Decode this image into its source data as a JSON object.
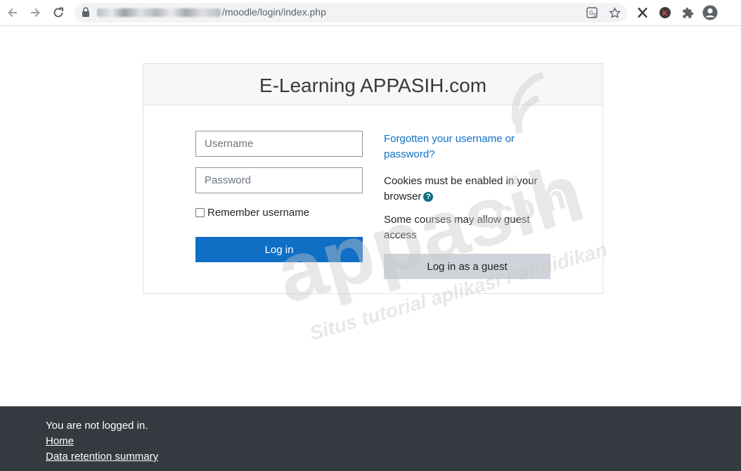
{
  "browser": {
    "url_visible": "/moodle/login/index.php",
    "icons": {
      "back": "arrow-left-icon",
      "forward": "arrow-right-icon",
      "reload": "reload-icon",
      "lock": "lock-icon",
      "translate": "translate-icon",
      "bookmark": "star-icon",
      "ext1": "x-extension-icon",
      "ext2": "k-extension-icon",
      "extensions": "puzzle-icon",
      "profile": "profile-icon"
    },
    "ext2_letter": "K"
  },
  "login": {
    "site_title": "E-Learning APPASIH.com",
    "username_placeholder": "Username",
    "password_placeholder": "Password",
    "remember_label": "Remember username",
    "remember_checked": false,
    "login_button": "Log in",
    "forgot_link": "Forgotten your username or password?",
    "cookies_notice": "Cookies must be enabled in your browser",
    "guest_notice": "Some courses may allow guest access",
    "guest_button": "Log in as a guest"
  },
  "watermark": {
    "brand": "appasih",
    "tld": ".com",
    "tagline": "Situs tutorial aplikasi Pandidikan"
  },
  "footer": {
    "status": "You are not logged in.",
    "home_link": "Home",
    "data_retention_link": "Data retention summary"
  },
  "colors": {
    "primary": "#0f6fc5",
    "secondary_button": "#ced4da",
    "footer_bg": "#343a40",
    "help_icon": "#0f6e83"
  }
}
